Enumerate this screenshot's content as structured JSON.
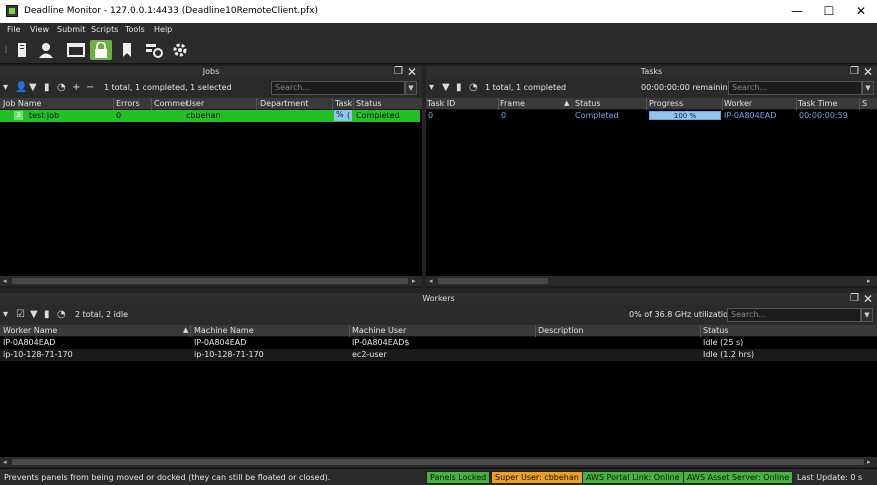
{
  "window": {
    "title": "Deadline Monitor  -  127.0.0.1:4433 (Deadline10RemoteClient.pfx)",
    "minimize": "—",
    "maximize": "☐",
    "close": "✕"
  },
  "menu": [
    "File",
    "View",
    "Submit",
    "Scripts",
    "Tools",
    "Help"
  ],
  "toolbar": {
    "icons": [
      "grip-icon",
      "monitor-icon",
      "user-icon",
      "window-icon",
      "lock-icon",
      "bookmark-icon",
      "settings-group-icon",
      "gear-icon"
    ],
    "active": "lock-icon"
  },
  "jobs": {
    "title": "Jobs",
    "status": "1 total, 1 completed, 1 selected",
    "search_placeholder": "Search...",
    "columns": [
      "Job Name",
      "Errors",
      "Commer",
      "User",
      "Department",
      "Task",
      "Status"
    ],
    "rows": [
      {
        "num": "3",
        "name": "test job",
        "errors": "0",
        "user": "cbbehan",
        "task": "%",
        "task2": "(",
        "status": "Completed"
      }
    ],
    "row_color": "#22c022"
  },
  "tasks": {
    "title": "Tasks",
    "status": "1 total, 1 completed",
    "remaining": "00:00:00:00 remaining",
    "search_placeholder": "Search...",
    "columns": [
      "Task ID",
      "Frame",
      "Status",
      "Progress",
      "Worker",
      "Task Time",
      "S"
    ],
    "rows": [
      {
        "task_id": "0",
        "frame": "0",
        "status": "Completed",
        "progress": "100 %",
        "progress_value": 100,
        "worker": "IP-0A804EAD",
        "task_time": "00:00:00:59"
      }
    ]
  },
  "workers": {
    "title": "Workers",
    "status": "2 total, 2 idle",
    "utilization": "0% of 36.8 GHz utilization",
    "search_placeholder": "Search...",
    "columns": [
      "Worker Name",
      "Machine Name",
      "Machine User",
      "Description",
      "Status"
    ],
    "rows": [
      {
        "worker": "IP-0A804EAD",
        "machine": "IP-0A804EAD",
        "user": "IP-0A804EAD$",
        "description": "",
        "status": "Idle (25 s)"
      },
      {
        "worker": "ip-10-128-71-170",
        "machine": "ip-10-128-71-170",
        "user": "ec2-user",
        "description": "",
        "status": "Idle (1.2 hrs)"
      }
    ]
  },
  "statusbar": {
    "message": "Prevents panels from being moved or docked (they can still be floated or closed).",
    "panels_locked": "Panels Locked",
    "super_user": "Super User: cbbehan",
    "aws_portal": "AWS Portal Link:  Online",
    "aws_asset": "AWS Asset Server:  Online",
    "last_update": "Last Update: 0 s"
  },
  "colors": {
    "accent_green": "#45b43c",
    "accent_orange": "#f0a020",
    "link_blue": "#6aa7e8"
  }
}
